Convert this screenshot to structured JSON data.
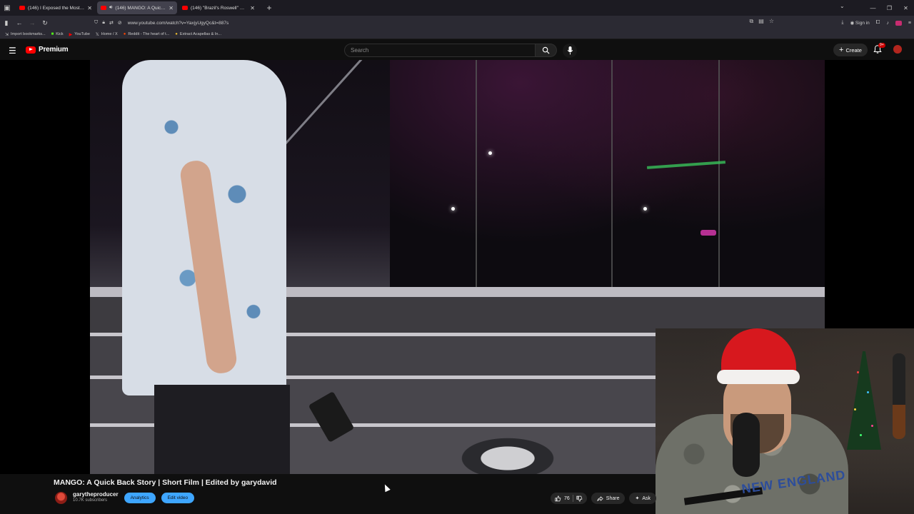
{
  "browser": {
    "tabs": [
      {
        "title": "(146) I Exposed the Most Evil C...",
        "active": false,
        "audio": false
      },
      {
        "title": "(146) MANGO: A Quick Bac...",
        "active": true,
        "audio": true
      },
      {
        "title": "(146) \"Brazil's Roswell\" Still a M...",
        "active": false,
        "audio": false
      }
    ],
    "url": "www.youtube.com/watch?v=YaxjyUgyQc&t=887s",
    "signin_label": "Sign in",
    "bookmarks": [
      {
        "label": "Import bookmarks...",
        "icon": "import-icon"
      },
      {
        "label": "Kick",
        "icon": "kick-icon"
      },
      {
        "label": "YouTube",
        "icon": "youtube-icon"
      },
      {
        "label": "Home / X",
        "icon": "x-icon"
      },
      {
        "label": "Reddit - The heart of t...",
        "icon": "reddit-icon"
      },
      {
        "label": "Extract Acapellas & In...",
        "icon": "folder-icon"
      }
    ]
  },
  "youtube": {
    "logo_text": "Premium",
    "search_placeholder": "Search",
    "create_label": "Create",
    "notifications_badge": "9+",
    "accent": "#ff0000"
  },
  "video": {
    "title": "MANGO: A Quick Back Story | Short Film | Edited by garydavid",
    "channel_name": "garytheproducer",
    "subscribers": "10.7K subscribers",
    "analytics_label": "Analytics",
    "edit_label": "Edit video",
    "like_count": "76",
    "share_label": "Share",
    "ask_label": "Ask"
  },
  "facecam": {
    "jersey_text": "NEW ENGLAND"
  }
}
